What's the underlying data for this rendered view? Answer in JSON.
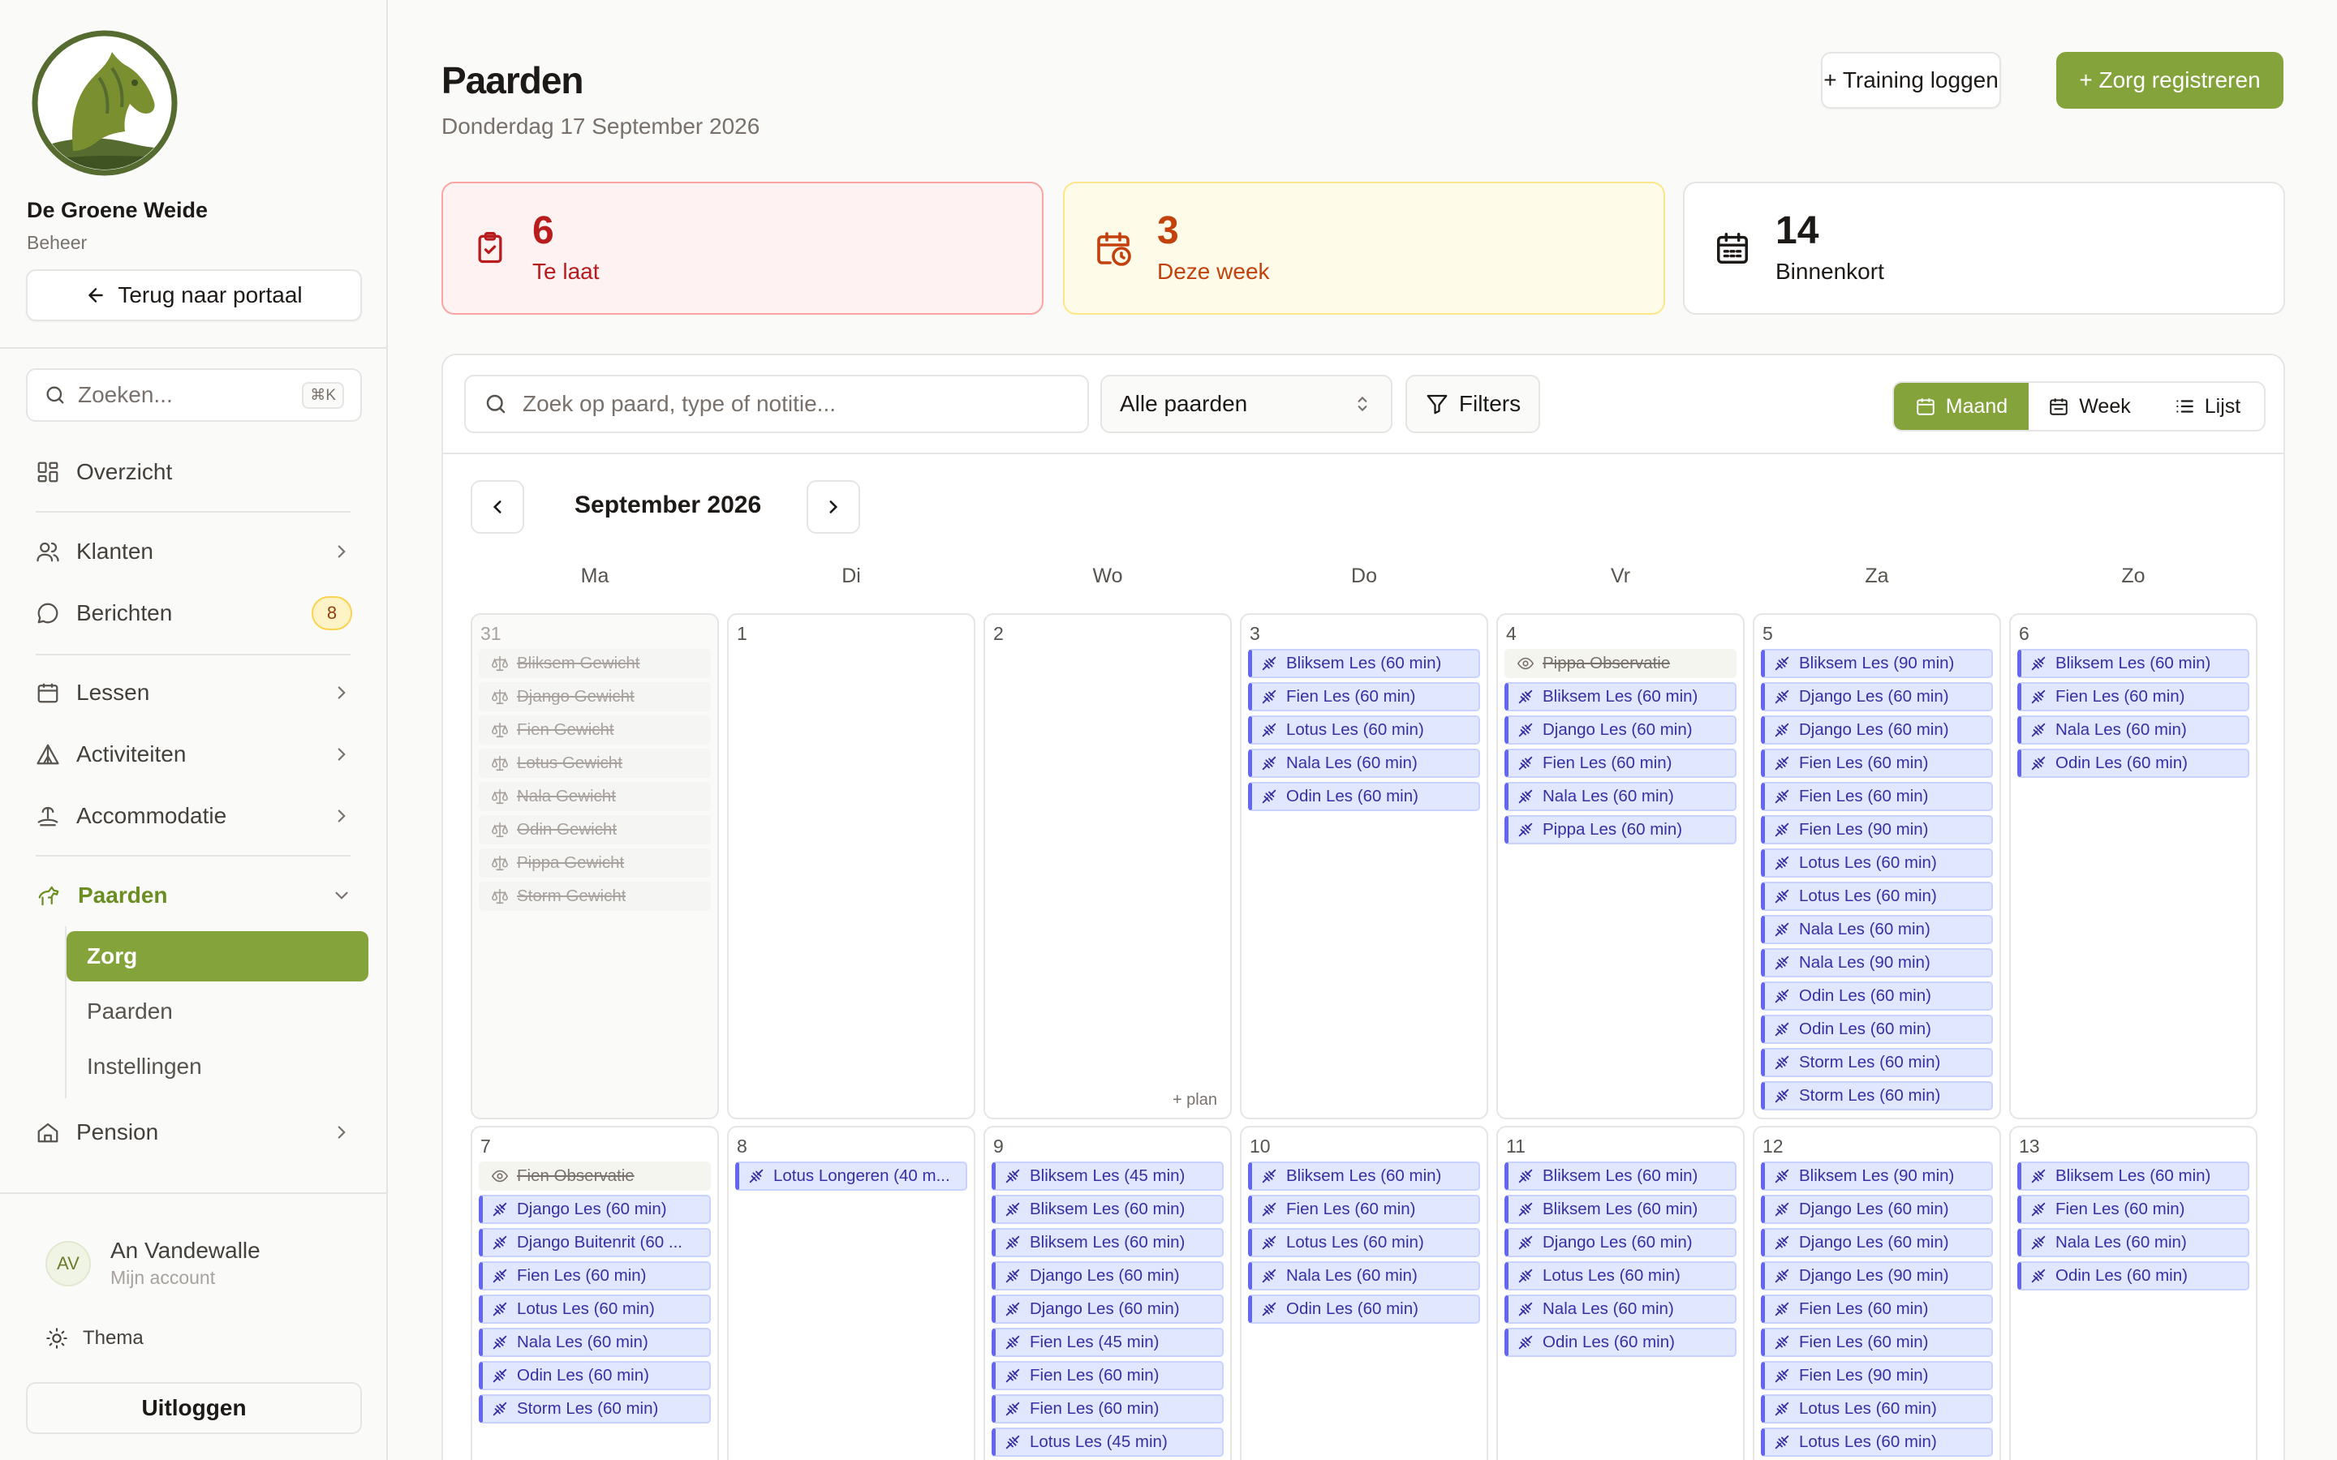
{
  "org": {
    "name": "De Groene Weide",
    "role": "Beheer",
    "back_label": "Terug naar portaal"
  },
  "sidebar": {
    "search_placeholder": "Zoeken...",
    "search_shortcut": "⌘K",
    "items": [
      {
        "label": "Overzicht",
        "icon": "grid-icon"
      },
      {
        "label": "Klanten",
        "icon": "users-icon"
      },
      {
        "label": "Berichten",
        "icon": "message-icon",
        "badge": "8"
      },
      {
        "label": "Lessen",
        "icon": "calendar-icon"
      },
      {
        "label": "Activiteiten",
        "icon": "tent-icon"
      },
      {
        "label": "Accommodatie",
        "icon": "bed-icon"
      },
      {
        "label": "Paarden",
        "icon": "horse-icon"
      },
      {
        "label": "Pension",
        "icon": "home-icon"
      }
    ],
    "sub_items": [
      "Zorg",
      "Paarden",
      "Instellingen"
    ]
  },
  "user": {
    "initials": "AV",
    "name": "An Vandewalle",
    "sub": "Mijn account",
    "theme_label": "Thema",
    "logout_label": "Uitloggen"
  },
  "header": {
    "title": "Paarden",
    "date": "Donderdag 17 September 2026",
    "btn_training": "+ Training loggen",
    "btn_care": "+ Zorg registreren"
  },
  "stats": [
    {
      "value": "6",
      "label": "Te laat",
      "icon": "clipboard-check-icon"
    },
    {
      "value": "3",
      "label": "Deze week",
      "icon": "calendar-clock-icon"
    },
    {
      "value": "14",
      "label": "Binnenkort",
      "icon": "calendar-icon"
    }
  ],
  "toolbar": {
    "search_placeholder": "Zoek op paard, type of notitie...",
    "horse_select": "Alle paarden",
    "filters_label": "Filters",
    "views": [
      "Maand",
      "Week",
      "Lijst"
    ],
    "active_view": "Maand"
  },
  "calendar": {
    "month_label": "September 2026",
    "weekdays": [
      "Ma",
      "Di",
      "Wo",
      "Do",
      "Vr",
      "Za",
      "Zo"
    ],
    "plan_label": "+ plan",
    "weeks": [
      [
        {
          "num": "31",
          "muted": true,
          "events": [
            {
              "t": "Bliksem Gewicht",
              "k": "done"
            },
            {
              "t": "Django Gewicht",
              "k": "done"
            },
            {
              "t": "Fien Gewicht",
              "k": "done"
            },
            {
              "t": "Lotus Gewicht",
              "k": "done"
            },
            {
              "t": "Nala Gewicht",
              "k": "done"
            },
            {
              "t": "Odin Gewicht",
              "k": "done"
            },
            {
              "t": "Pippa Gewicht",
              "k": "done"
            },
            {
              "t": "Storm Gewicht",
              "k": "done"
            }
          ]
        },
        {
          "num": "1",
          "events": []
        },
        {
          "num": "2",
          "events": [],
          "plan": true
        },
        {
          "num": "3",
          "events": [
            {
              "t": "Bliksem Les (60 min)"
            },
            {
              "t": "Fien Les (60 min)"
            },
            {
              "t": "Lotus Les (60 min)"
            },
            {
              "t": "Nala Les (60 min)"
            },
            {
              "t": "Odin Les (60 min)"
            }
          ]
        },
        {
          "num": "4",
          "events": [
            {
              "t": "Pippa Observatie",
              "k": "obs"
            },
            {
              "t": "Bliksem Les (60 min)"
            },
            {
              "t": "Django Les (60 min)"
            },
            {
              "t": "Fien Les (60 min)"
            },
            {
              "t": "Nala Les (60 min)"
            },
            {
              "t": "Pippa Les (60 min)"
            }
          ]
        },
        {
          "num": "5",
          "events": [
            {
              "t": "Bliksem Les (90 min)"
            },
            {
              "t": "Django Les (60 min)"
            },
            {
              "t": "Django Les (60 min)"
            },
            {
              "t": "Fien Les (60 min)"
            },
            {
              "t": "Fien Les (60 min)"
            },
            {
              "t": "Fien Les (90 min)"
            },
            {
              "t": "Lotus Les (60 min)"
            },
            {
              "t": "Lotus Les (60 min)"
            },
            {
              "t": "Nala Les (60 min)"
            },
            {
              "t": "Nala Les (90 min)"
            },
            {
              "t": "Odin Les (60 min)"
            },
            {
              "t": "Odin Les (60 min)"
            },
            {
              "t": "Storm Les (60 min)"
            },
            {
              "t": "Storm Les (60 min)"
            }
          ]
        },
        {
          "num": "6",
          "events": [
            {
              "t": "Bliksem Les (60 min)"
            },
            {
              "t": "Fien Les (60 min)"
            },
            {
              "t": "Nala Les (60 min)"
            },
            {
              "t": "Odin Les (60 min)"
            }
          ]
        }
      ],
      [
        {
          "num": "7",
          "events": [
            {
              "t": "Fien Observatie",
              "k": "obs"
            },
            {
              "t": "Django Les (60 min)"
            },
            {
              "t": "Django Buitenrit (60 ..."
            },
            {
              "t": "Fien Les (60 min)"
            },
            {
              "t": "Lotus Les (60 min)"
            },
            {
              "t": "Nala Les (60 min)"
            },
            {
              "t": "Odin Les (60 min)"
            },
            {
              "t": "Storm Les (60 min)"
            }
          ]
        },
        {
          "num": "8",
          "events": [
            {
              "t": "Lotus Longeren (40 m..."
            }
          ]
        },
        {
          "num": "9",
          "events": [
            {
              "t": "Bliksem Les (45 min)"
            },
            {
              "t": "Bliksem Les (60 min)"
            },
            {
              "t": "Bliksem Les (60 min)"
            },
            {
              "t": "Django Les (60 min)"
            },
            {
              "t": "Django Les (60 min)"
            },
            {
              "t": "Fien Les (45 min)"
            },
            {
              "t": "Fien Les (60 min)"
            },
            {
              "t": "Fien Les (60 min)"
            },
            {
              "t": "Lotus Les (45 min)"
            }
          ]
        },
        {
          "num": "10",
          "events": [
            {
              "t": "Bliksem Les (60 min)"
            },
            {
              "t": "Fien Les (60 min)"
            },
            {
              "t": "Lotus Les (60 min)"
            },
            {
              "t": "Nala Les (60 min)"
            },
            {
              "t": "Odin Les (60 min)"
            }
          ]
        },
        {
          "num": "11",
          "events": [
            {
              "t": "Bliksem Les (60 min)"
            },
            {
              "t": "Bliksem Les (60 min)"
            },
            {
              "t": "Django Les (60 min)"
            },
            {
              "t": "Lotus Les (60 min)"
            },
            {
              "t": "Nala Les (60 min)"
            },
            {
              "t": "Odin Les (60 min)"
            }
          ]
        },
        {
          "num": "12",
          "events": [
            {
              "t": "Bliksem Les (90 min)"
            },
            {
              "t": "Django Les (60 min)"
            },
            {
              "t": "Django Les (60 min)"
            },
            {
              "t": "Django Les (90 min)"
            },
            {
              "t": "Fien Les (60 min)"
            },
            {
              "t": "Fien Les (60 min)"
            },
            {
              "t": "Fien Les (90 min)"
            },
            {
              "t": "Lotus Les (60 min)"
            },
            {
              "t": "Lotus Les (60 min)"
            }
          ]
        },
        {
          "num": "13",
          "events": [
            {
              "t": "Bliksem Les (60 min)"
            },
            {
              "t": "Fien Les (60 min)"
            },
            {
              "t": "Nala Les (60 min)"
            },
            {
              "t": "Odin Les (60 min)"
            }
          ]
        }
      ]
    ]
  }
}
